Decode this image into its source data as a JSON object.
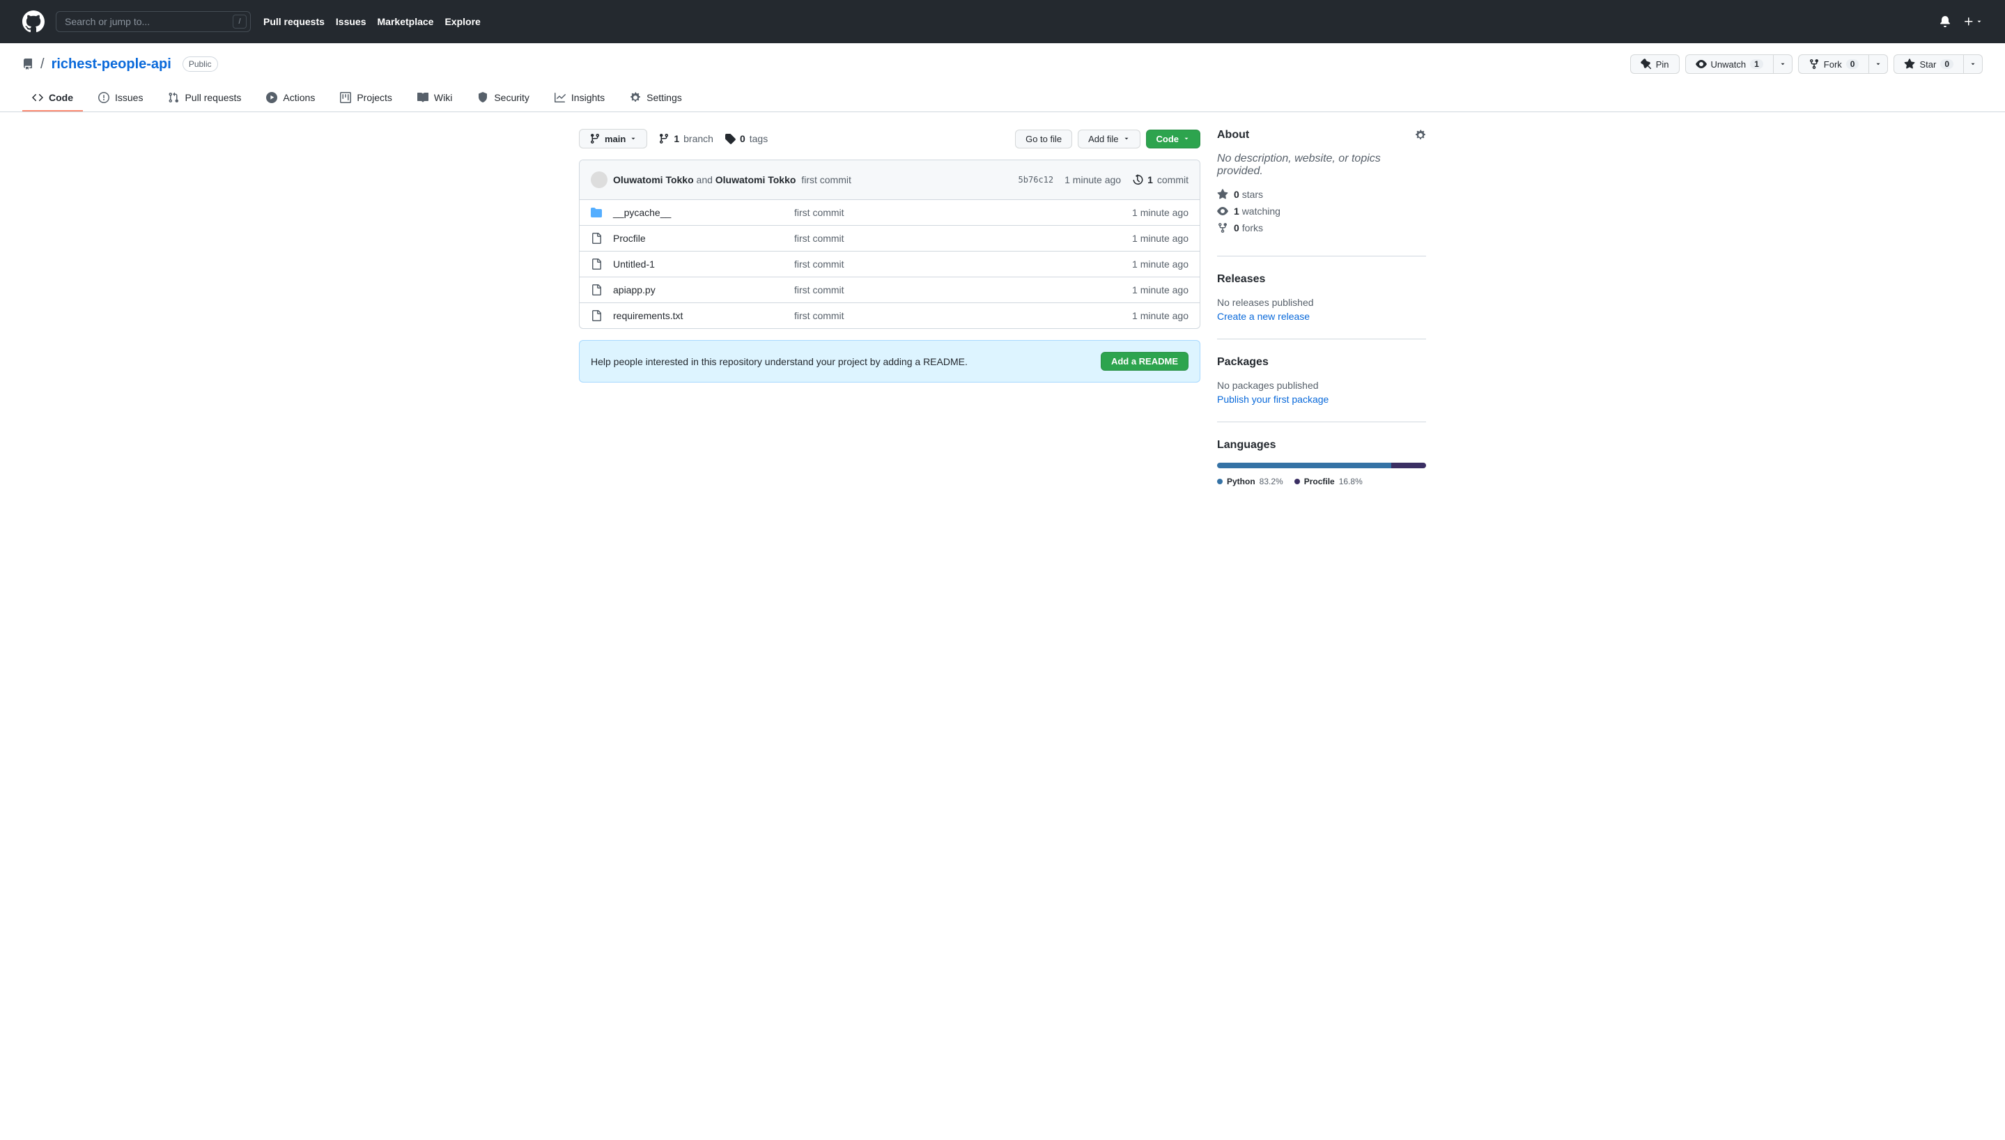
{
  "search": {
    "placeholder": "Search or jump to..."
  },
  "topnav": {
    "pull_requests": "Pull requests",
    "issues": "Issues",
    "marketplace": "Marketplace",
    "explore": "Explore"
  },
  "repo": {
    "name": "richest-people-api",
    "visibility": "Public"
  },
  "actions": {
    "pin": "Pin",
    "unwatch": "Unwatch",
    "unwatch_count": "1",
    "fork": "Fork",
    "fork_count": "0",
    "star": "Star",
    "star_count": "0"
  },
  "tabs": {
    "code": "Code",
    "issues": "Issues",
    "pulls": "Pull requests",
    "actions": "Actions",
    "projects": "Projects",
    "wiki": "Wiki",
    "security": "Security",
    "insights": "Insights",
    "settings": "Settings"
  },
  "branch": {
    "current": "main",
    "branch_count": "1",
    "branch_label": "branch",
    "tag_count": "0",
    "tag_label": "tags"
  },
  "buttons": {
    "go_to_file": "Go to file",
    "add_file": "Add file",
    "code": "Code"
  },
  "commit": {
    "author1": "Oluwatomi Tokko",
    "and": "and",
    "author2": "Oluwatomi Tokko",
    "message": "first commit",
    "sha": "5b76c12",
    "time": "1 minute ago",
    "commits_count": "1",
    "commits_label": "commit"
  },
  "files": [
    {
      "type": "dir",
      "name": "__pycache__",
      "msg": "first commit",
      "time": "1 minute ago"
    },
    {
      "type": "file",
      "name": "Procfile",
      "msg": "first commit",
      "time": "1 minute ago"
    },
    {
      "type": "file",
      "name": "Untitled-1",
      "msg": "first commit",
      "time": "1 minute ago"
    },
    {
      "type": "file",
      "name": "apiapp.py",
      "msg": "first commit",
      "time": "1 minute ago"
    },
    {
      "type": "file",
      "name": "requirements.txt",
      "msg": "first commit",
      "time": "1 minute ago"
    }
  ],
  "readme_prompt": {
    "text": "Help people interested in this repository understand your project by adding a README.",
    "button": "Add a README"
  },
  "about": {
    "heading": "About",
    "description": "No description, website, or topics provided.",
    "stars_count": "0",
    "stars_label": "stars",
    "watching_count": "1",
    "watching_label": "watching",
    "forks_count": "0",
    "forks_label": "forks"
  },
  "releases": {
    "heading": "Releases",
    "none": "No releases published",
    "link": "Create a new release"
  },
  "packages": {
    "heading": "Packages",
    "none": "No packages published",
    "link": "Publish your first package"
  },
  "languages": {
    "heading": "Languages",
    "items": [
      {
        "name": "Python",
        "pct": "83.2%",
        "color": "#3572A5"
      },
      {
        "name": "Procfile",
        "pct": "16.8%",
        "color": "#3B2F63"
      }
    ]
  }
}
